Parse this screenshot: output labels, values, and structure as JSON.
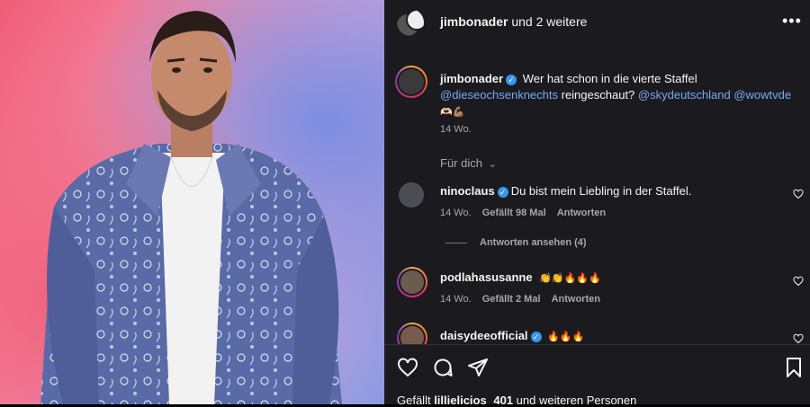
{
  "header": {
    "title_user": "jimbonader",
    "title_rest": " und 2 weitere",
    "more_icon": "more-horizontal-icon"
  },
  "caption": {
    "username": "jimbonader",
    "line1": "Wer hat schon in die vierte Staffel",
    "mention1": "@dieseochsenknechts",
    "line2": " reingeschaut? ",
    "mention2": "@skydeutschland",
    "mention3": " @wowtvde",
    "emojis": "🫶🏻💪🏽",
    "time": "14 Wo."
  },
  "sort_label": "Für dich",
  "comments": [
    {
      "username": "ninoclaus",
      "verified": true,
      "text": "Du bist mein Liebling in der Staffel.",
      "time": "14 Wo.",
      "likes": "Gefällt 98 Mal",
      "reply": "Antworten",
      "view_replies": "Antworten ansehen (4)"
    },
    {
      "username": "podlahasusanne",
      "verified": false,
      "text": "👏👏🔥🔥🔥",
      "time": "14 Wo.",
      "likes": "Gefällt 2 Mal",
      "reply": "Antworten"
    },
    {
      "username": "daisydeeofficial",
      "verified": true,
      "text": "🔥🔥🔥"
    }
  ],
  "likes_line": {
    "prefix": "Gefällt ",
    "user": "lillielicios",
    "count": "401",
    "suffix": " und weiteren Personen"
  },
  "colors": {
    "panel_bg": "#1b1b1f",
    "mention": "#7aa7f5",
    "verified": "#3897f0"
  }
}
